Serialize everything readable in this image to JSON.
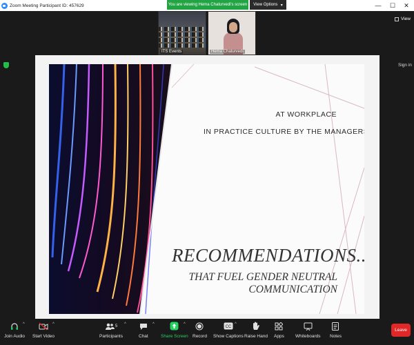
{
  "window": {
    "title": "Zoom Meeting Participant ID: 457629",
    "viewing_banner": "You are viewing Hema Chaturvedi's screen",
    "view_options_label": "View Options",
    "controls": [
      "—",
      "☐",
      "✕"
    ]
  },
  "participants": [
    {
      "name": "ITS Events"
    },
    {
      "name": "Hema Chaturvedi"
    }
  ],
  "view_label": "View",
  "signin_label": "Sign in",
  "slide": {
    "line1": "AT WORKPLACE",
    "line2": "IN PRACTICE CULTURE BY THE MANAGERS.",
    "heading": "RECOMMENDATIONS...",
    "subheading1": "THAT FUEL GENDER NEUTRAL",
    "subheading2": "COMMUNICATION"
  },
  "toolbar": {
    "join_audio": "Join Audio",
    "start_video": "Start Video",
    "participants": "Participants",
    "participants_count": "5",
    "chat": "Chat",
    "share_screen": "Share Screen",
    "record": "Record",
    "show_captions": "Show Captions",
    "raise_hand": "Raise Hand",
    "apps": "Apps",
    "whiteboards": "Whiteboards",
    "notes": "Notes",
    "leave": "Leave"
  },
  "colors": {
    "banner_green": "#23a444",
    "share_green": "#23d160",
    "leave_red": "#e02828",
    "zoom_blue": "#2d8cff"
  }
}
